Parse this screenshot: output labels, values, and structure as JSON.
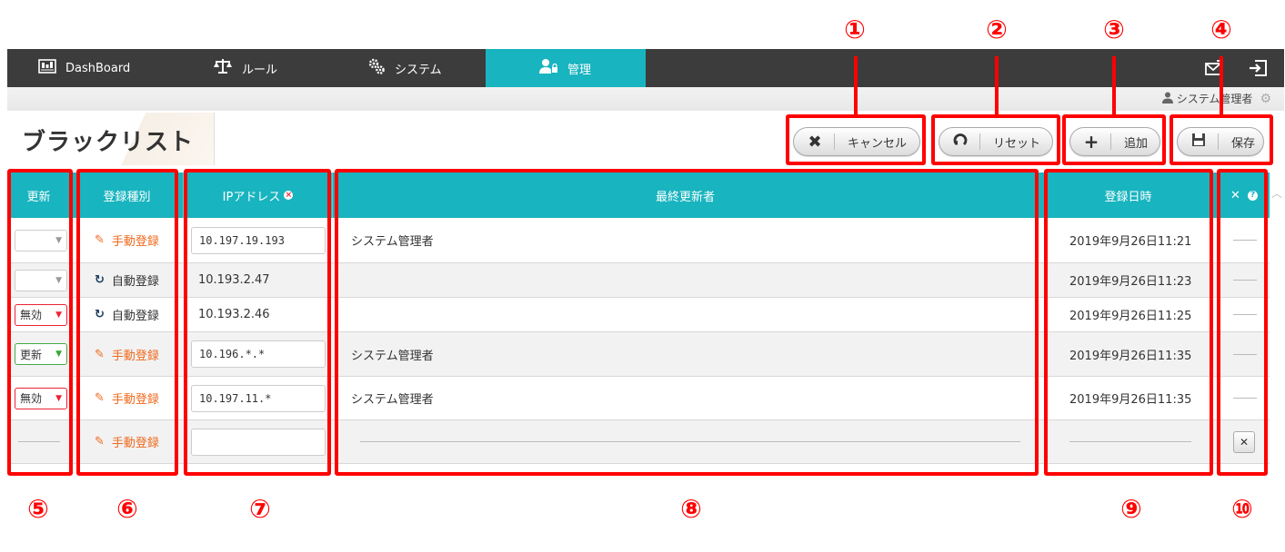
{
  "nav": {
    "items": [
      {
        "label": "DashBoard",
        "icon": "dashboard-icon"
      },
      {
        "label": "ルール",
        "icon": "scale-icon"
      },
      {
        "label": "システム",
        "icon": "gears-icon"
      },
      {
        "label": "管理",
        "icon": "admin-user-icon"
      }
    ],
    "active": "管理"
  },
  "user": {
    "name": "システム管理者"
  },
  "page": {
    "title": "ブラックリスト"
  },
  "toolbar": {
    "cancel_label": "キャンセル",
    "reset_label": "リセット",
    "add_label": "追加",
    "save_label": "保存"
  },
  "table": {
    "headers": {
      "update": "更新",
      "reg_type": "登録種別",
      "ip": "IPアドレス",
      "updater": "最終更新者",
      "reg_date": "登録日時"
    },
    "rows": [
      {
        "update": "",
        "type": "手動登録",
        "ip": "10.197.19.193",
        "updater": "システム管理者",
        "date": "2019年9月26日11:21"
      },
      {
        "update": "",
        "type": "自動登録",
        "ip": "10.193.2.47",
        "updater": "",
        "date": "2019年9月26日11:23"
      },
      {
        "update": "無効",
        "type": "自動登録",
        "ip": "10.193.2.46",
        "updater": "",
        "date": "2019年9月26日11:25"
      },
      {
        "update": "更新",
        "type": "手動登録",
        "ip": "10.196.*.*",
        "updater": "システム管理者",
        "date": "2019年9月26日11:35"
      },
      {
        "update": "無効",
        "type": "手動登録",
        "ip": "10.197.11.*",
        "updater": "システム管理者",
        "date": "2019年9月26日11:35"
      },
      {
        "update": "",
        "type": "手動登録",
        "ip": "",
        "updater": "",
        "date": ""
      }
    ]
  },
  "annotations": [
    "①",
    "②",
    "③",
    "④",
    "⑤",
    "⑥",
    "⑦",
    "⑧",
    "⑨",
    "⑩"
  ],
  "colors": {
    "accent": "#18b4bf",
    "nav_bg": "#3c3c3c",
    "annotation": "#ff0000",
    "manual": "#f06a1e"
  }
}
